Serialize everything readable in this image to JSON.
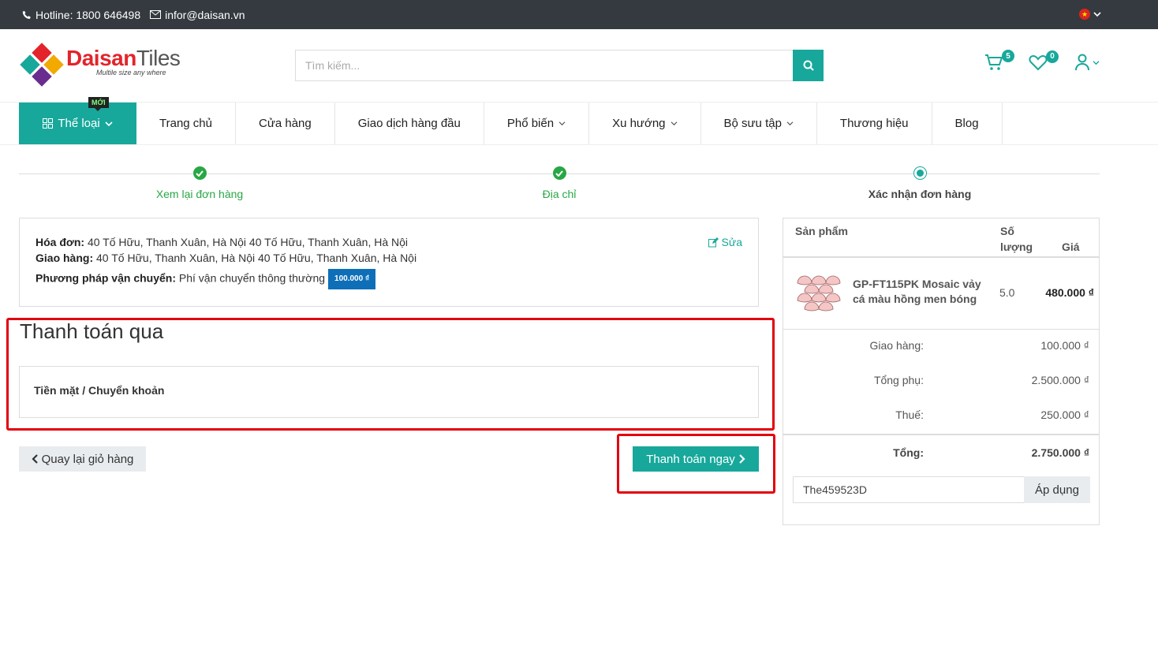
{
  "topbar": {
    "hotline": "Hotline: 1800 646498",
    "email": "infor@daisan.vn"
  },
  "logo": {
    "brand_red": "Daisan",
    "brand_gray": "Tiles",
    "tagline": "Multile size any where"
  },
  "search": {
    "placeholder": "Tìm kiếm..."
  },
  "header_icons": {
    "cart_count": "5",
    "wishlist_count": "0"
  },
  "nav": {
    "category_label": "Thể loại",
    "new_badge": "MỚI",
    "items": [
      "Trang chủ",
      "Cửa hàng",
      "Giao dịch hàng đầu",
      "Phổ biến",
      "Xu hướng",
      "Bộ sưu tập",
      "Thương hiệu",
      "Blog"
    ]
  },
  "steps": [
    {
      "label": "Xem lại đơn hàng",
      "state": "done"
    },
    {
      "label": "Địa chỉ",
      "state": "done"
    },
    {
      "label": "Xác nhận đơn hàng",
      "state": "current"
    }
  ],
  "order_info": {
    "invoice_label": "Hóa đơn:",
    "invoice_value": "40 Tố Hữu, Thanh Xuân, Hà Nội 40 Tố Hữu, Thanh Xuân, Hà Nội",
    "shipping_label": "Giao hàng:",
    "shipping_value": "40 Tố Hữu, Thanh Xuân, Hà Nội 40 Tố Hữu, Thanh Xuân, Hà Nội",
    "method_label": "Phương pháp vận chuyển:",
    "method_value": "Phí vận chuyển thông thường",
    "method_price": "100.000 ₫",
    "edit_label": "Sửa"
  },
  "payment": {
    "title": "Thanh toán qua",
    "option": "Tiền mặt / Chuyển khoản"
  },
  "actions": {
    "back_label": "Quay lại giỏ hàng",
    "pay_label": "Thanh toán ngay"
  },
  "summary": {
    "col_product": "Sản phẩm",
    "col_qty_line1": "Số",
    "col_qty_line2": "lượng",
    "col_price": "Giá",
    "product": {
      "name": "GP-FT115PK Mosaic vảy cá màu hồng men bóng",
      "qty": "5.0",
      "price": "480.000 ₫"
    },
    "rows": [
      {
        "label": "Giao hàng:",
        "value": "100.000 ₫"
      },
      {
        "label": "Tổng phụ:",
        "value": "2.500.000 ₫"
      },
      {
        "label": "Thuế:",
        "value": "250.000 ₫"
      }
    ],
    "total_label": "Tổng:",
    "total_value": "2.750.000 ₫",
    "coupon_value": "The459523D",
    "apply_label": "Áp dụng"
  },
  "colors": {
    "accent": "#17a89b",
    "success": "#28a745",
    "highlight": "#e3000f",
    "price_tag": "#0e6fb8"
  }
}
